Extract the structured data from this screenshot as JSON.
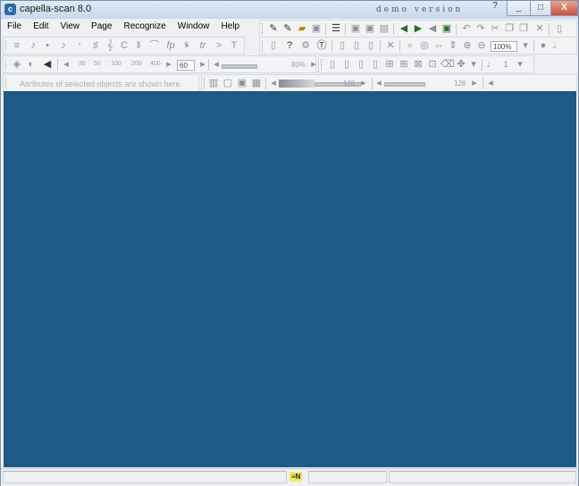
{
  "window": {
    "app_icon": "capella-icon",
    "title": "capella-scan 8.0",
    "watermark": "demo version",
    "help_glyph": "?",
    "controls": [
      "_",
      "□",
      "X"
    ]
  },
  "menu": [
    {
      "label": "File"
    },
    {
      "label": "Edit"
    },
    {
      "label": "View"
    },
    {
      "label": "Page"
    },
    {
      "label": "Recognize"
    },
    {
      "label": "Window"
    },
    {
      "label": "Help"
    }
  ],
  "toolbar_symbols": {
    "icons": [
      "lines",
      "eighth-note",
      "dot",
      "eighth-note",
      "rest",
      "sharp",
      "treble-clef",
      "common-time",
      "barline",
      "slur",
      "fp-dynamic",
      "segno",
      "trill",
      "accent",
      "text"
    ]
  },
  "toolbar_scale": {
    "ticks": [
      "30",
      "50",
      "100",
      "200",
      "400"
    ],
    "value": "60",
    "zoom_right": "80%"
  },
  "toolbar_zoom": {
    "value": "100%"
  },
  "toolbar_attrs": {
    "placeholder": "Attributes of selected objects are shown here.",
    "slider1_value": "128",
    "slider2_value": "128"
  },
  "colors": {
    "workspace": "#1e5a84",
    "titlebar": "#c8d8ec",
    "close_button": "#c9513a",
    "status_badge": "#f1e860"
  },
  "status": {
    "badge": "≡N"
  }
}
